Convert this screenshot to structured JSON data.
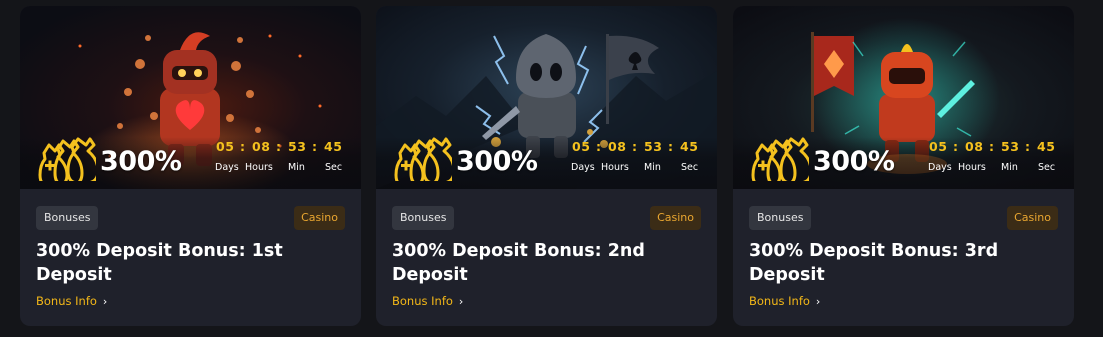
{
  "cards": [
    {
      "percent": "300%",
      "timer": {
        "days": "05",
        "hours": "08",
        "min": "53",
        "sec": "45"
      },
      "timer_labels": {
        "days": "Days",
        "hours": "Hours",
        "min": "Min",
        "sec": "Sec"
      },
      "category_tag": "Bonuses",
      "type_tag": "Casino",
      "title": "300% Deposit Bonus: 1st Deposit",
      "link": "Bonus Info",
      "chevron": "›",
      "illustration": "red-knight-heart"
    },
    {
      "percent": "300%",
      "timer": {
        "days": "05",
        "hours": "08",
        "min": "53",
        "sec": "45"
      },
      "timer_labels": {
        "days": "Days",
        "hours": "Hours",
        "min": "Min",
        "sec": "Sec"
      },
      "category_tag": "Bonuses",
      "type_tag": "Casino",
      "title": "300% Deposit Bonus: 2nd Deposit",
      "link": "Bonus Info",
      "chevron": "›",
      "illustration": "grey-knight-spade-flag"
    },
    {
      "percent": "300%",
      "timer": {
        "days": "05",
        "hours": "08",
        "min": "53",
        "sec": "45"
      },
      "timer_labels": {
        "days": "Days",
        "hours": "Hours",
        "min": "Min",
        "sec": "Sec"
      },
      "category_tag": "Bonuses",
      "type_tag": "Casino",
      "title": "300% Deposit Bonus: 3rd Deposit",
      "link": "Bonus Info",
      "chevron": "›",
      "illustration": "red-knight-diamond-flag"
    }
  ],
  "colors": {
    "page_bg": "#141519",
    "card_bg": "#1f212b",
    "timer": "#f4c11e",
    "link": "#f4b818",
    "casino_tag_text": "#e9a630",
    "casino_tag_bg": "#3b2c16",
    "bonuses_tag_bg": "#33363f"
  }
}
